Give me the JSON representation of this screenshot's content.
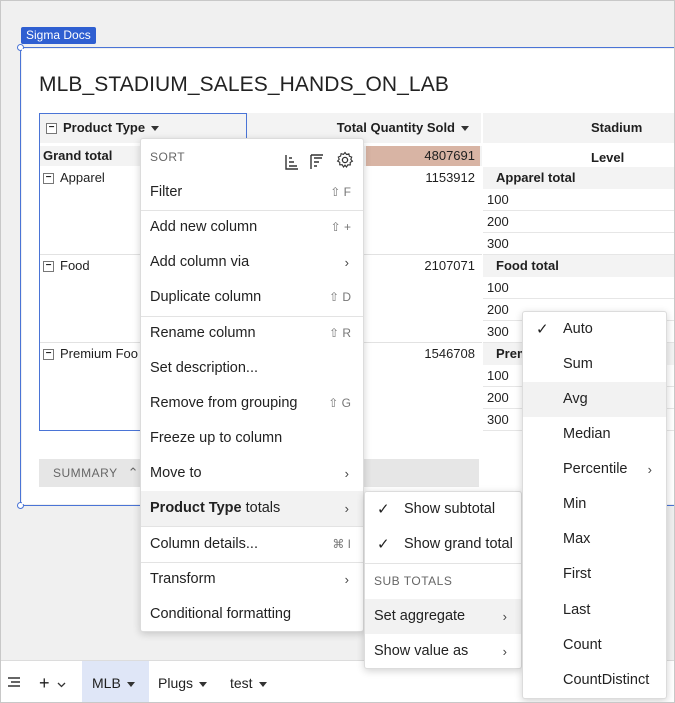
{
  "badge": "Sigma Docs",
  "title": "MLB_STADIUM_SALES_HANDS_ON_LAB",
  "table": {
    "col_product_type": "Product Type",
    "col_total_qty": "Total Quantity Sold",
    "col_stadium_level": "Stadium Level",
    "grand_total_label": "Grand total",
    "grand_total_value": "4807691",
    "rows": [
      {
        "name": "Apparel",
        "value": "1153912"
      },
      {
        "name": "Food",
        "value": "2107071"
      },
      {
        "name": "Premium Foo",
        "value": "1546708"
      }
    ],
    "stadium": {
      "apparel_total": "Apparel total",
      "food_total": "Food total",
      "premium_partial": "Prem",
      "levels": [
        "100",
        "200",
        "300"
      ]
    },
    "summary": "SUMMARY"
  },
  "context_menu": {
    "sort_label": "SORT",
    "items": [
      {
        "label": "Filter",
        "shortcut": "⇧ F"
      },
      {
        "label": "Add new column",
        "shortcut": "⇧ +"
      },
      {
        "label": "Add column via",
        "arrow": "›"
      },
      {
        "label": "Duplicate column",
        "shortcut": "⇧ D"
      },
      {
        "label": "Rename column",
        "shortcut": "⇧ R"
      },
      {
        "label": "Set description..."
      },
      {
        "label": "Remove from grouping",
        "shortcut": "⇧ G"
      },
      {
        "label": "Freeze up to column"
      },
      {
        "label": "Move to",
        "arrow": "›"
      },
      {
        "label_bold": "Product Type",
        "label_rest": " totals",
        "arrow": "›"
      },
      {
        "label": "Column details...",
        "shortcut": "⌘ I"
      },
      {
        "label": "Transform",
        "arrow": "›"
      },
      {
        "label": "Conditional formatting"
      }
    ]
  },
  "totals_menu": {
    "show_subtotal": "Show subtotal",
    "show_grand_total": "Show grand total",
    "section": "SUB TOTALS",
    "set_aggregate": "Set aggregate",
    "show_value_as": "Show value as"
  },
  "aggregate_menu": {
    "items": [
      "Auto",
      "Sum",
      "Avg",
      "Median",
      "Percentile",
      "Min",
      "Max",
      "First",
      "Last",
      "Count",
      "CountDistinct"
    ],
    "selected": "Auto",
    "hovered": "Avg"
  },
  "bottom_tabs": {
    "tabs": [
      "MLB",
      "Plugs",
      "test"
    ],
    "active": "MLB"
  }
}
